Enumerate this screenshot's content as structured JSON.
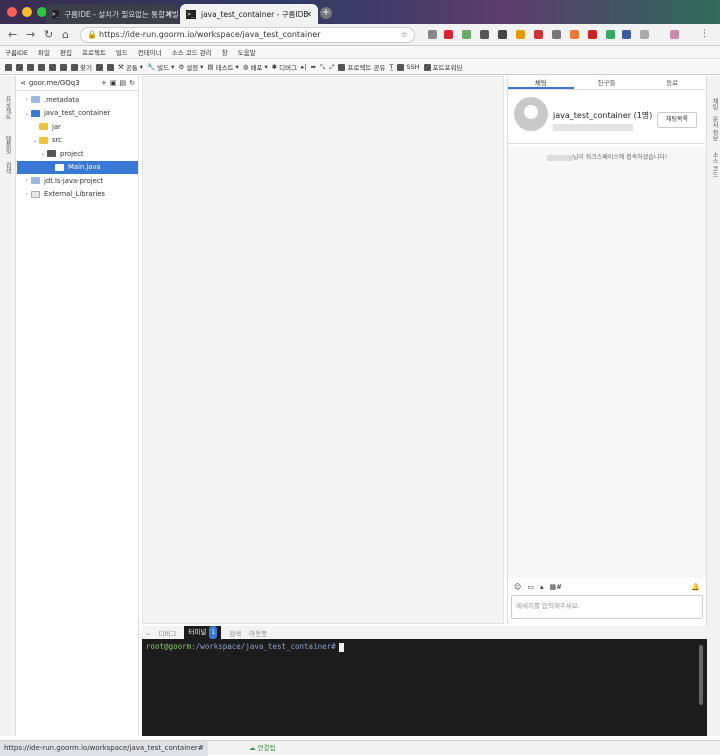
{
  "browser": {
    "tabs": [
      {
        "title": "구름IDE - 설치가 필요없는 통합개발환경",
        "active": false
      },
      {
        "title": "java_test_container - 구름IDE",
        "active": true
      }
    ],
    "url": "https://ide-run.goorm.io/workspace/java_test_container",
    "status_url": "https://ide-run.goorm.io/workspace/java_test_container#"
  },
  "menu": [
    "구름IDE",
    "파일",
    "편집",
    "프로젝트",
    "빌드",
    "컨테이너",
    "소스 코드 관리",
    "창",
    "도움말"
  ],
  "toolbar": {
    "find": "찾기",
    "common": "공통",
    "build": "빌드",
    "settings": "설정",
    "test": "테스트",
    "deploy": "배포",
    "debug": "디버그",
    "share": "프로젝트 공유",
    "ssh": "SSH",
    "port": "포트포워딩"
  },
  "left_strip": [
    "프로젝트",
    "템플릿",
    "검색"
  ],
  "explorer": {
    "project": "goor.me/GQq3",
    "items": [
      {
        "label": ".metadata",
        "level": 1,
        "arrow": "›"
      },
      {
        "label": "java_test_container",
        "level": 1,
        "arrow": "⌄"
      },
      {
        "label": "jar",
        "level": 2,
        "arrow": ""
      },
      {
        "label": "src",
        "level": 2,
        "arrow": "⌄"
      },
      {
        "label": "project",
        "level": 3,
        "arrow": "⌄"
      },
      {
        "label": "Main.java",
        "level": 4,
        "arrow": ""
      },
      {
        "label": "jdt.ls-java-project",
        "level": 1,
        "arrow": "›"
      },
      {
        "label": "External_Libraries",
        "level": 1,
        "arrow": "›"
      }
    ]
  },
  "chat": {
    "tabs": [
      "채팅",
      "친구들",
      "동료"
    ],
    "room_name": "java_test_container (1명)",
    "list_button": "채팅목록",
    "message": "님이 워크스페이스에 접속하셨습니다!",
    "input_placeholder": "메세지를 입력해주세요."
  },
  "right_strip": [
    "채팅",
    "문서 정보",
    "소스 코드"
  ],
  "terminal": {
    "tabs": [
      "디버그",
      "터미널",
      "검색",
      "아웃풋"
    ],
    "badge": "1",
    "user": "root@goorm",
    "path": ":/workspace/java_test_container#"
  },
  "status": {
    "connection": "연결됨"
  },
  "colors": {
    "accent": "#3a78d6",
    "terminal_bg": "#1c1c1c",
    "prompt_user": "#7fd060"
  }
}
